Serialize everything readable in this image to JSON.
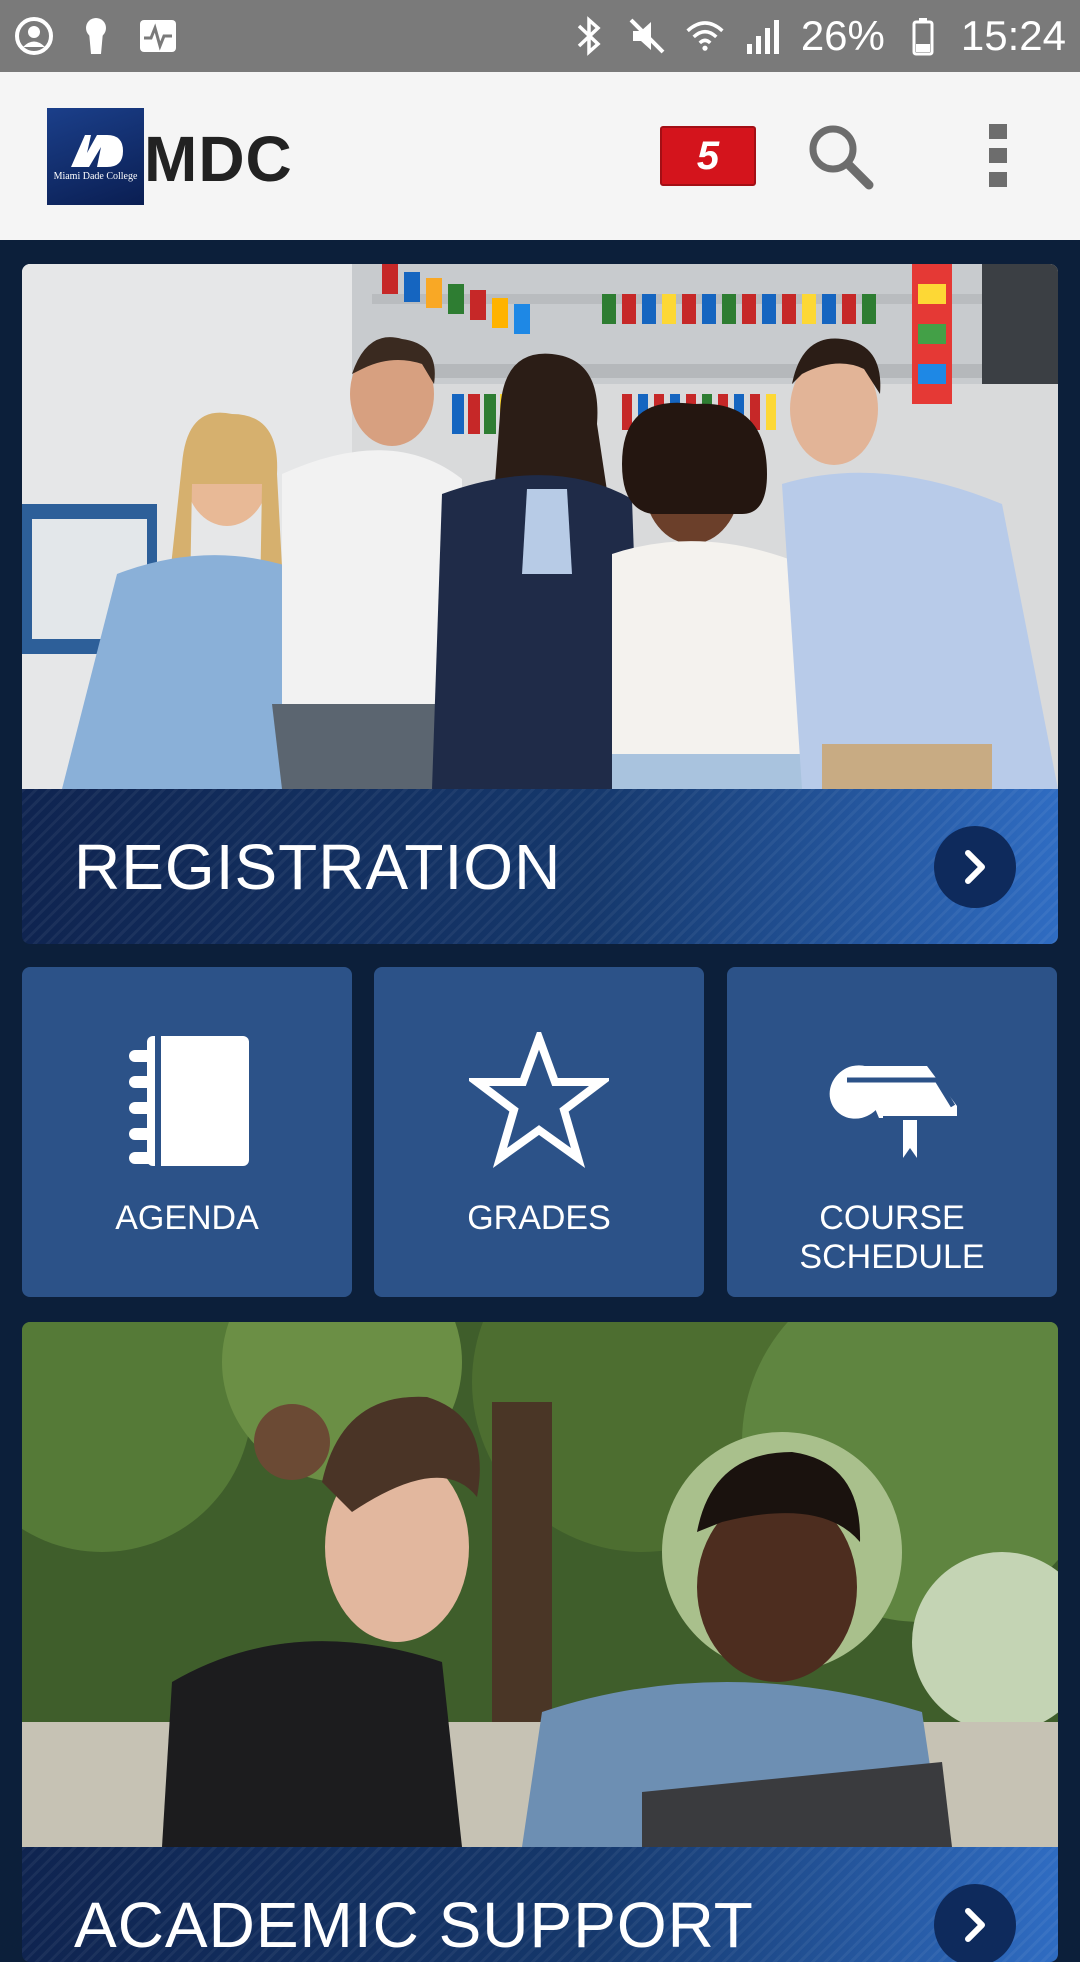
{
  "status_bar": {
    "battery": "26%",
    "time": "15:24",
    "icons": [
      "account-circle-icon",
      "keyhole-icon",
      "activity-icon",
      "bluetooth-icon",
      "mute-icon",
      "wifi-icon",
      "signal-icon",
      "battery-icon"
    ]
  },
  "app_bar": {
    "logo_text": "Miami Dade College",
    "title": "MDC",
    "notification_count": "5",
    "colors": {
      "badge": "#d4141c",
      "background": "#f5f5f5"
    }
  },
  "cards": {
    "registration": {
      "label": "REGISTRATION"
    },
    "academic_support": {
      "label": "ACADEMIC SUPPORT"
    }
  },
  "tiles": [
    {
      "label": "AGENDA",
      "icon": "notebook-icon"
    },
    {
      "label": "GRADES",
      "icon": "star-icon"
    },
    {
      "label": "COURSE SCHEDULE",
      "icon": "diploma-icon"
    }
  ],
  "colors": {
    "page_background": "#0c1f3a",
    "tile": "#2c5288",
    "banner_dark": "#0f2450",
    "banner_light": "#2f6cc2"
  }
}
